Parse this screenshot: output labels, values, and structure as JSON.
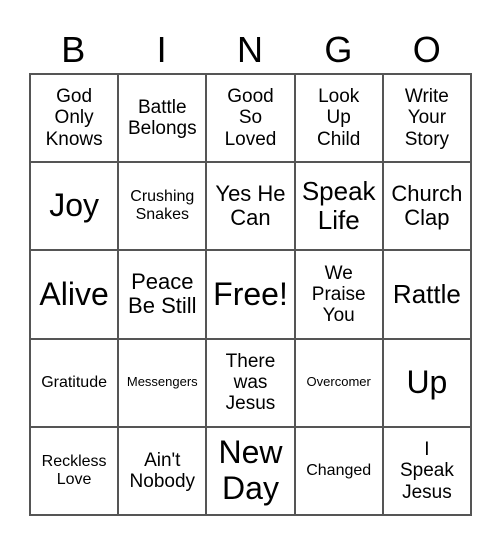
{
  "header": [
    "B",
    "I",
    "N",
    "G",
    "O"
  ],
  "cells": [
    [
      "God\nOnly\nKnows",
      "Battle\nBelongs",
      "Good\nSo\nLoved",
      "Look\nUp\nChild",
      "Write\nYour\nStory"
    ],
    [
      "Joy",
      "Crushing\nSnakes",
      "Yes He\nCan",
      "Speak\nLife",
      "Church\nClap"
    ],
    [
      "Alive",
      "Peace\nBe Still",
      "Free!",
      "We\nPraise\nYou",
      "Rattle"
    ],
    [
      "Gratitude",
      "Messengers",
      "There\nwas\nJesus",
      "Overcomer",
      "Up"
    ],
    [
      "Reckless\nLove",
      "Ain't\nNobody",
      "New\nDay",
      "Changed",
      "I\nSpeak\nJesus"
    ]
  ]
}
